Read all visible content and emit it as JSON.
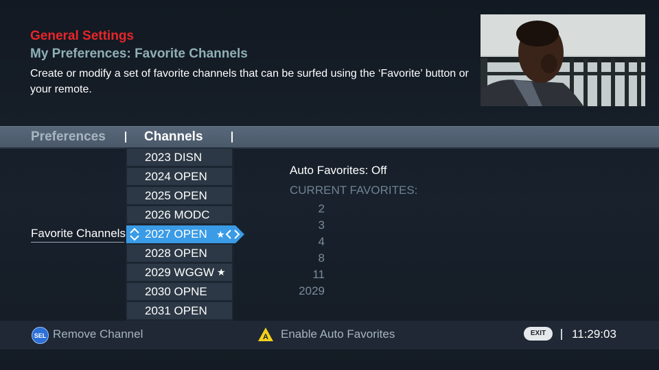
{
  "header": {
    "title": "General Settings",
    "subtitle": "My Preferences: Favorite Channels",
    "description": "Create or modify a set of favorite channels that can be surfed using the ‘Favorite’ button or your remote."
  },
  "tabs": [
    {
      "label": "Preferences",
      "selected": false
    },
    {
      "label": "Channels",
      "selected": true
    }
  ],
  "favorite_channels_label": "Favorite Channels",
  "channels": [
    {
      "label": "2023 DISN",
      "favorite": false
    },
    {
      "label": "2024 OPEN",
      "favorite": false
    },
    {
      "label": "2025 OPEN",
      "favorite": false
    },
    {
      "label": "2026 MODC",
      "favorite": false
    },
    {
      "label": "2027 OPEN",
      "favorite": true,
      "selected": true
    },
    {
      "label": "2028 OPEN",
      "favorite": false
    },
    {
      "label": "2029 WGGW",
      "favorite": true
    },
    {
      "label": "2030 OPNE",
      "favorite": false
    },
    {
      "label": "2031 OPEN",
      "favorite": false
    }
  ],
  "star_glyph": "★",
  "auto_favorites": "Auto Favorites: Off",
  "current_favorites": {
    "heading": "CURRENT FAVORITES:",
    "items": [
      "2",
      "3",
      "4",
      "8",
      "11",
      "2029"
    ]
  },
  "footer": {
    "sel_badge": "SEL",
    "remove_label": "Remove Channel",
    "a_badge": "A",
    "enable_label": "Enable Auto Favorites",
    "exit_badge": "EXIT",
    "time": "11:29:03"
  },
  "colors": {
    "title_red": "#e8262a",
    "subtitle_teal": "#8fb0b6",
    "selection_blue": "#3a9be6",
    "tab_bar": "#4f5e70",
    "sel_button_blue": "#2c6fd8",
    "a_button_yellow": "#f2d21b"
  },
  "icons": {
    "updown": "updown-arrows-icon",
    "leftright": "left-right-arrows-icon",
    "star": "star-icon",
    "sel": "sel-button-icon",
    "a": "a-button-icon",
    "exit": "exit-button-icon"
  }
}
